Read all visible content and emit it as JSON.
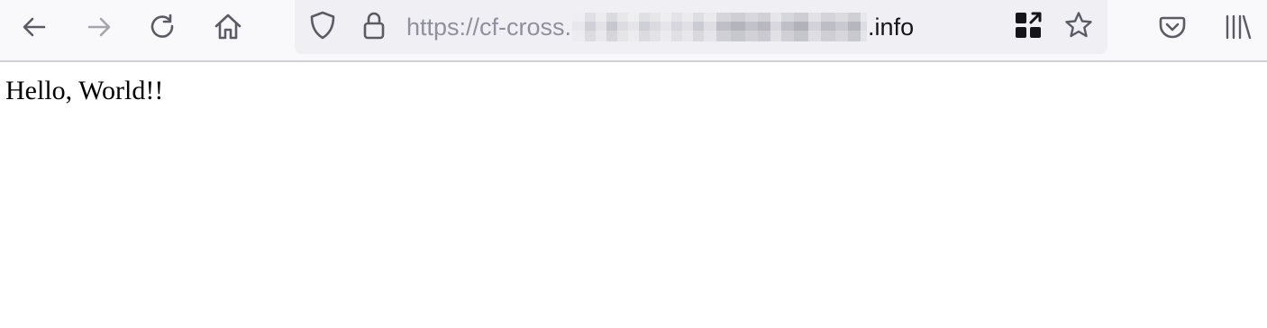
{
  "browser": {
    "toolbar": {
      "back_icon": "back-arrow-icon",
      "forward_icon": "forward-arrow-icon",
      "reload_icon": "reload-icon",
      "home_icon": "home-icon",
      "pocket_icon": "pocket-icon",
      "library_icon": "library-icon",
      "forward_disabled": true
    },
    "urlbar": {
      "tracking_icon": "shield-icon",
      "security_icon": "lock-icon",
      "url_prefix": "https://cf-cross.",
      "url_suffix": ".info",
      "url_middle_redacted": true,
      "page_action_icon": "qr-code-share-icon",
      "bookmark_icon": "star-icon"
    },
    "colors": {
      "toolbar_bg": "#f9f9fb",
      "urlbar_bg": "#f0f0f4",
      "icon": "#5b5b66",
      "icon_disabled": "#a5a5ae",
      "url_dim": "#8f8f9d",
      "url_main": "#15141a"
    }
  },
  "page": {
    "body_text": "Hello, World!!"
  }
}
